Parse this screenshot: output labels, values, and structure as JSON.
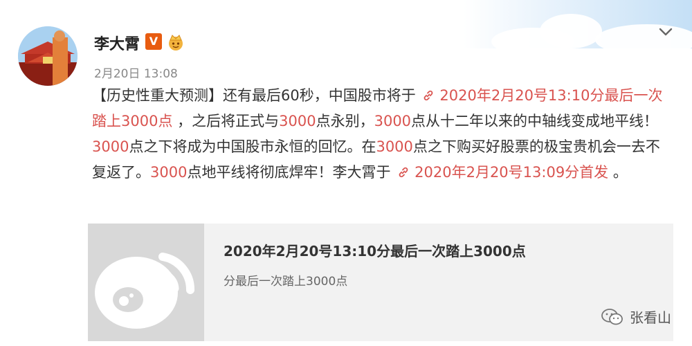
{
  "post": {
    "author_name": "李大霄",
    "verified_badge": "V",
    "timestamp": "2月20日 13:08",
    "segments": [
      {
        "text": "【历史性重大预测】还有最后60秒，中国股市将于 ",
        "style": "normal"
      },
      {
        "text": "2020年2月20号13:10分最后一次踏上3000点",
        "style": "link"
      },
      {
        "text": " ，之后将正式与",
        "style": "normal"
      },
      {
        "text": "3000",
        "style": "red"
      },
      {
        "text": "点永别，",
        "style": "normal"
      },
      {
        "text": "3000",
        "style": "red"
      },
      {
        "text": "点从十二年以来的中轴线变成地平线！",
        "style": "normal"
      },
      {
        "text": "3000",
        "style": "red"
      },
      {
        "text": "点之下将成为中国股市永恒的回忆。在",
        "style": "normal"
      },
      {
        "text": "3000",
        "style": "red"
      },
      {
        "text": "点之下购买好股票的极宝贵机会一去不复返了。",
        "style": "normal"
      },
      {
        "text": "3000",
        "style": "red"
      },
      {
        "text": "点地平线将彻底焊牢！李大霄于 ",
        "style": "normal"
      },
      {
        "text": "2020年2月20号13:09分首发",
        "style": "link"
      },
      {
        "text": " 。",
        "style": "normal"
      }
    ]
  },
  "card": {
    "title": "2020年2月20号13:10分最后一次踏上3000点",
    "subtitle": "分最后一次踏上3000点"
  },
  "watermark": {
    "text": "张看山"
  },
  "colors": {
    "accent": "#d9534f",
    "badge": "#e85c10",
    "card_bg": "#f2f2f2"
  },
  "icons": {
    "menu": "chevron-down-icon",
    "link": "link-icon",
    "card_logo": "weibo-logo-icon",
    "watermark": "wechat-icon"
  }
}
